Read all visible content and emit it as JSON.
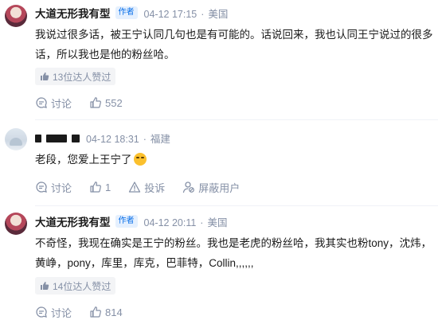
{
  "comments": [
    {
      "author": "大道无形我有型",
      "badge": "作者",
      "date": "04-12 17:15",
      "dot": "·",
      "location": "美国",
      "text": "我说过很多话，被王宁认同几句也是有可能的。话说回来，我也认同王宁说过的很多话，所以我也是他的粉丝哈。",
      "likes_badge": "13位达人赞过",
      "reply_label": "讨论",
      "like_count": "552"
    },
    {
      "date": "04-12 18:31",
      "dot": "·",
      "location": "福建",
      "text": "老段，您爱上王宁了",
      "reply_label": "讨论",
      "like_count": "1",
      "report_label": "投诉",
      "block_label": "屏蔽用户"
    },
    {
      "author": "大道无形我有型",
      "badge": "作者",
      "date": "04-12 20:11",
      "dot": "·",
      "location": "美国",
      "text": "不奇怪，我现在确实是王宁的粉丝。我也是老虎的粉丝哈，我其实也粉tony，沈炜，黄峥，pony，库里，库克，巴菲特，Collin,,,,,,",
      "likes_badge": "14位达人赞过",
      "reply_label": "讨论",
      "like_count": "814"
    }
  ],
  "colors": {
    "accent": "#056de8",
    "meta": "#8590a6",
    "text": "#1a1a1a"
  }
}
